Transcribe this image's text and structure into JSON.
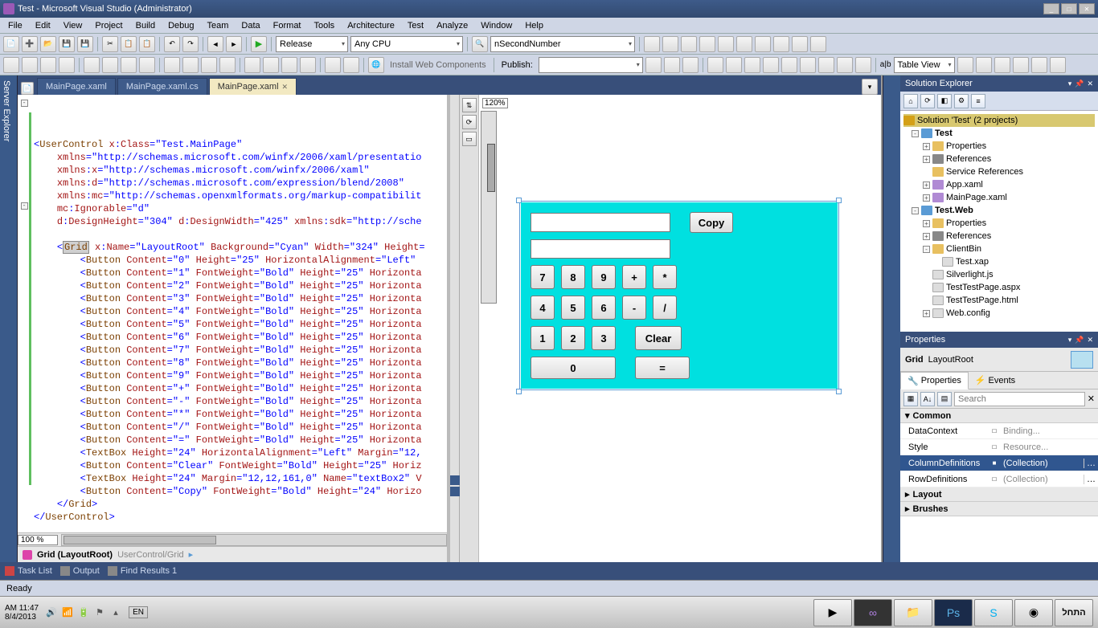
{
  "title": "Test - Microsoft Visual Studio (Administrator)",
  "menu": [
    "File",
    "Edit",
    "View",
    "Project",
    "Build",
    "Debug",
    "Team",
    "Data",
    "Format",
    "Tools",
    "Architecture",
    "Test",
    "Analyze",
    "Window",
    "Help"
  ],
  "config": "Release",
  "platform": "Any CPU",
  "findtarget": "nSecondNumber",
  "tb2": {
    "install": "Install Web Components",
    "publish": "Publish:",
    "tableview": "Table View"
  },
  "tabs": [
    {
      "label": "MainPage.xaml",
      "active": false
    },
    {
      "label": "MainPage.xaml.cs",
      "active": false
    },
    {
      "label": "MainPage.xaml",
      "active": true
    }
  ],
  "zoom_code": "100 %",
  "zoom_design": "120%",
  "breadcrumb": {
    "el": "Grid (LayoutRoot)",
    "path": "UserControl/Grid"
  },
  "code": {
    "l1a": "<",
    "l1b": "UserControl ",
    "l1c": "x",
    "l1d": ":",
    "l1e": "Class",
    "l1f": "=\"Test.MainPage\"",
    "l2a": "xmlns",
    "l2b": "=\"http://schemas.microsoft.com/winfx/2006/xaml/presentatio",
    "l3a": "xmlns",
    "l3b": ":",
    "l3c": "x",
    "l3d": "=\"http://schemas.microsoft.com/winfx/2006/xaml\"",
    "l4a": "xmlns",
    "l4b": ":",
    "l4c": "d",
    "l4d": "=\"http://schemas.microsoft.com/expression/blend/2008\"",
    "l5a": "xmlns",
    "l5b": ":",
    "l5c": "mc",
    "l5d": "=\"http://schemas.openxmlformats.org/markup-compatibilit",
    "l6a": "mc",
    "l6b": ":",
    "l6c": "Ignorable",
    "l6d": "=\"d\"",
    "l7a": "d",
    "l7b": ":",
    "l7c": "DesignHeight",
    "l7d": "=\"304\" ",
    "l7e": "d",
    "l7f": ":",
    "l7g": "DesignWidth",
    "l7h": "=\"425\" ",
    "l7i": "xmlns",
    "l7j": ":",
    "l7k": "sdk",
    "l7l": "=\"http://sche",
    "l9a": "<",
    "l9b": "Grid",
    "l9c": " x",
    "l9d": ":",
    "l9e": "Name",
    "l9f": "=\"LayoutRoot\" ",
    "l9g": "Background",
    "l9h": "=\"Cyan\" ",
    "l9i": "Width",
    "l9j": "=\"324\" ",
    "l9k": "Height",
    "l9l": "=",
    "btn0": "<Button Content=\"0\" Height=\"25\" HorizontalAlignment=\"Left\"",
    "btn1": "<Button Content=\"1\" FontWeight=\"Bold\" Height=\"25\" Horizonta",
    "btn2": "<Button Content=\"2\" FontWeight=\"Bold\" Height=\"25\" Horizonta",
    "btn3": "<Button Content=\"3\" FontWeight=\"Bold\" Height=\"25\" Horizonta",
    "btn4": "<Button Content=\"4\" FontWeight=\"Bold\" Height=\"25\" Horizonta",
    "btn5": "<Button Content=\"5\" FontWeight=\"Bold\" Height=\"25\" Horizonta",
    "btn6": "<Button Content=\"6\" FontWeight=\"Bold\" Height=\"25\" Horizonta",
    "btn7": "<Button Content=\"7\" FontWeight=\"Bold\" Height=\"25\" Horizonta",
    "btn8": "<Button Content=\"8\" FontWeight=\"Bold\" Height=\"25\" Horizonta",
    "btn9": "<Button Content=\"9\" FontWeight=\"Bold\" Height=\"25\" Horizonta",
    "btnp": "<Button Content=\"+\" FontWeight=\"Bold\" Height=\"25\" Horizonta",
    "btnm": "<Button Content=\"-\" FontWeight=\"Bold\" Height=\"25\" Horizonta",
    "btns": "<Button Content=\"*\" FontWeight=\"Bold\" Height=\"25\" Horizonta",
    "btnd": "<Button Content=\"/\" FontWeight=\"Bold\" Height=\"25\" Horizonta",
    "btne": "<Button Content=\"=\" FontWeight=\"Bold\" Height=\"25\" Horizonta",
    "tb1": "<TextBox Height=\"24\" HorizontalAlignment=\"Left\" Margin=\"12,",
    "btnc": "<Button Content=\"Clear\" FontWeight=\"Bold\" Height=\"25\" Horiz",
    "tb2": "<TextBox Height=\"24\" Margin=\"12,12,161,0\" Name=\"textBox2\" V",
    "btncp": "<Button Content=\"Copy\" FontWeight=\"Bold\" Height=\"24\" Horizo",
    "cg": "</",
    "cgn": "Grid",
    "cge": ">",
    "cuc": "</",
    "cucn": "UserControl",
    "cuce": ">"
  },
  "calc": {
    "copy": "Copy",
    "clear": "Clear",
    "k7": "7",
    "k8": "8",
    "k9": "9",
    "kp": "+",
    "ks": "*",
    "k4": "4",
    "k5": "5",
    "k6": "6",
    "km": "-",
    "kd": "/",
    "k1": "1",
    "k2": "2",
    "k3": "3",
    "k0": "0",
    "ke": "="
  },
  "solexp": {
    "title": "Solution Explorer",
    "sln": "Solution 'Test' (2 projects)",
    "proj1": "Test",
    "props": "Properties",
    "refs": "References",
    "svcref": "Service References",
    "appx": "App.xaml",
    "mainx": "MainPage.xaml",
    "proj2": "Test.Web",
    "clientbin": "ClientBin",
    "testxap": "Test.xap",
    "sljs": "Silverlight.js",
    "ttpa": "TestTestPage.aspx",
    "ttph": "TestTestPage.html",
    "webc": "Web.config"
  },
  "props": {
    "title": "Properties",
    "grid": "Grid",
    "name": "LayoutRoot",
    "tabp": "Properties",
    "tabe": "Events",
    "search_ph": "Search",
    "cat_common": "Common",
    "dc": "DataContext",
    "dcv": "Binding...",
    "style": "Style",
    "stylev": "Resource...",
    "coldef": "ColumnDefinitions",
    "coldefv": "(Collection)",
    "rowdef": "RowDefinitions",
    "rowdefv": "(Collection)",
    "cat_layout": "Layout",
    "cat_brush": "Brushes"
  },
  "bottom": {
    "tasklist": "Task List",
    "output": "Output",
    "findres": "Find Results 1"
  },
  "status": "Ready",
  "leftgutter": "Server Explorer",
  "taskbar": {
    "time": "AM 11:47",
    "date": "8/4/2013",
    "lang": "EN",
    "start": "התחל"
  }
}
